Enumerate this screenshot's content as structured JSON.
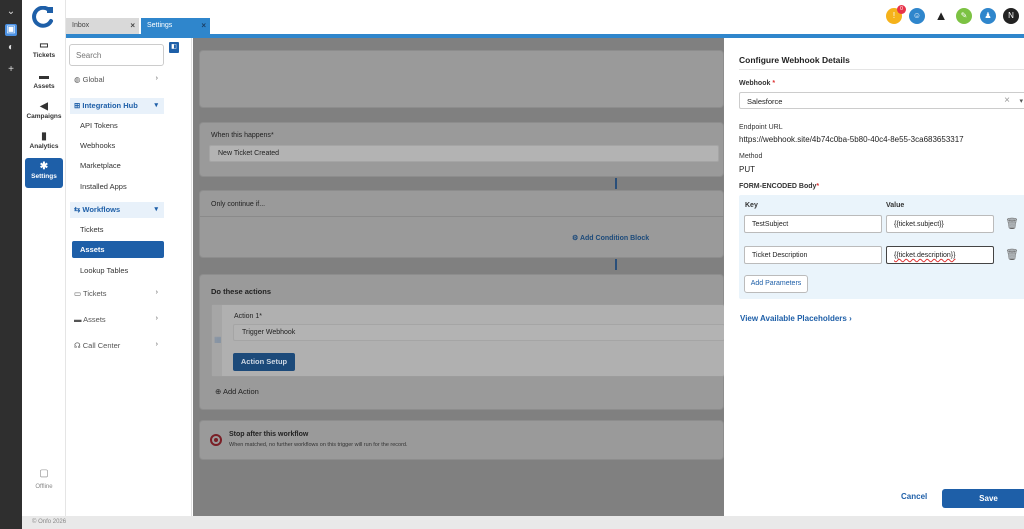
{
  "tabs": [
    {
      "label": "Inbox"
    },
    {
      "label": "Settings"
    }
  ],
  "header": {
    "notification_count": "0",
    "user_initial": "N"
  },
  "left_nav": {
    "items": [
      {
        "label": "Tickets"
      },
      {
        "label": "Assets"
      },
      {
        "label": "Campaigns"
      },
      {
        "label": "Analytics"
      },
      {
        "label": "Settings"
      }
    ],
    "status": "Offline"
  },
  "settings_nav": {
    "search_placeholder": "Search",
    "global": "Global",
    "integration_hub": "Integration Hub",
    "integration_items": [
      "API Tokens",
      "Webhooks",
      "Marketplace",
      "Installed Apps"
    ],
    "workflows": "Workflows",
    "workflow_items": [
      "Tickets",
      "Assets",
      "Lookup Tables"
    ],
    "tickets": "Tickets",
    "assets": "Assets",
    "call_center": "Call Center"
  },
  "workflow": {
    "trigger_label": "When this happens",
    "trigger_required": "*",
    "trigger_value": "New Ticket Created",
    "condition_title": "Only continue if...",
    "add_condition": "Add Condition Block",
    "actions_title": "Do these actions",
    "action_label": "Action 1",
    "action_required": "*",
    "action_value": "Trigger Webhook",
    "action_setup": "Action Setup",
    "add_action": "Add Action",
    "stop_title": "Stop after this workflow",
    "stop_desc": "When matched, no further workflows on this trigger will run for the record."
  },
  "panel": {
    "title": "Configure Webhook Details",
    "webhook_label": "Webhook",
    "required": "*",
    "webhook_value": "Salesforce",
    "endpoint_label": "Endpoint URL",
    "endpoint_value": "https://webhook.site/4b74c0ba-5b80-40c4-8e55-3ca683653317",
    "method_label": "Method",
    "method_value": "PUT",
    "body_label": "FORM-ENCODED Body",
    "key_header": "Key",
    "value_header": "Value",
    "rows": [
      {
        "key": "TestSubject",
        "value": "{{ticket.subject}}"
      },
      {
        "key": "Ticket Description",
        "value": "{{ticket.description}}"
      }
    ],
    "add_params": "Add Parameters",
    "view_placeholders": "View Available Placeholders",
    "cancel": "Cancel",
    "save": "Save"
  },
  "footer": {
    "copyright": "© Onfo 2026"
  },
  "colors": {
    "primary": "#1e5fa8",
    "tab_active": "#2f86cc",
    "overlay": "#808080",
    "body_box": "#eaf4fb"
  }
}
